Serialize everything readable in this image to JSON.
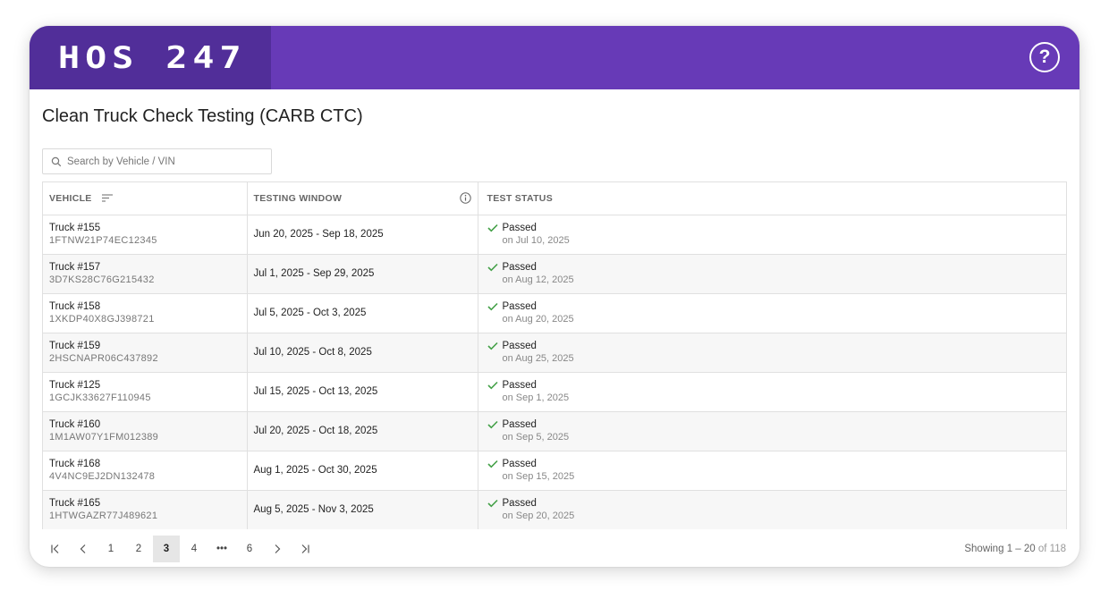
{
  "app": {
    "logo_text": "HOS 247",
    "help_icon": "question-circle-icon",
    "colors": {
      "header": "#673ab7",
      "logo_block": "#512e99",
      "passed": "#43a047"
    }
  },
  "page": {
    "title": "Clean Truck Check Testing (CARB CTC)"
  },
  "search": {
    "placeholder": "Search by Vehicle / VIN",
    "value": ""
  },
  "table": {
    "headers": {
      "vehicle": "VEHICLE",
      "window": "TESTING WINDOW",
      "status": "TEST STATUS"
    },
    "rows": [
      {
        "vehicle": "Truck #155",
        "vin": "1FTNW21P74EC12345",
        "window": "Jun 20, 2025 - Sep 18, 2025",
        "status": "Passed",
        "status_date": "on Jul 10, 2025"
      },
      {
        "vehicle": "Truck #157",
        "vin": "3D7KS28C76G215432",
        "window": "Jul 1, 2025 - Sep 29, 2025",
        "status": "Passed",
        "status_date": "on Aug 12, 2025"
      },
      {
        "vehicle": "Truck #158",
        "vin": "1XKDP40X8GJ398721",
        "window": "Jul 5, 2025 - Oct 3, 2025",
        "status": "Passed",
        "status_date": "on Aug 20, 2025"
      },
      {
        "vehicle": "Truck #159",
        "vin": "2HSCNAPR06C437892",
        "window": "Jul 10, 2025 - Oct 8, 2025",
        "status": "Passed",
        "status_date": "on Aug 25, 2025"
      },
      {
        "vehicle": "Truck #125",
        "vin": "1GCJK33627F110945",
        "window": "Jul 15, 2025 - Oct 13, 2025",
        "status": "Passed",
        "status_date": "on Sep 1, 2025"
      },
      {
        "vehicle": "Truck #160",
        "vin": "1M1AW07Y1FM012389",
        "window": "Jul 20, 2025 - Oct 18, 2025",
        "status": "Passed",
        "status_date": "on Sep 5, 2025"
      },
      {
        "vehicle": "Truck #168",
        "vin": "4V4NC9EJ2DN132478",
        "window": "Aug 1, 2025 - Oct 30, 2025",
        "status": "Passed",
        "status_date": "on Sep 15, 2025"
      },
      {
        "vehicle": "Truck #165",
        "vin": "1HTWGAZR77J489621",
        "window": "Aug 5, 2025 - Nov 3, 2025",
        "status": "Passed",
        "status_date": "on Sep 20, 2025"
      }
    ]
  },
  "pagination": {
    "pages": [
      "1",
      "2",
      "3",
      "4",
      "•••",
      "6"
    ],
    "current": "3",
    "showing_prefix": "Showing",
    "showing_range": "1 – 20",
    "showing_of": "of 118"
  }
}
